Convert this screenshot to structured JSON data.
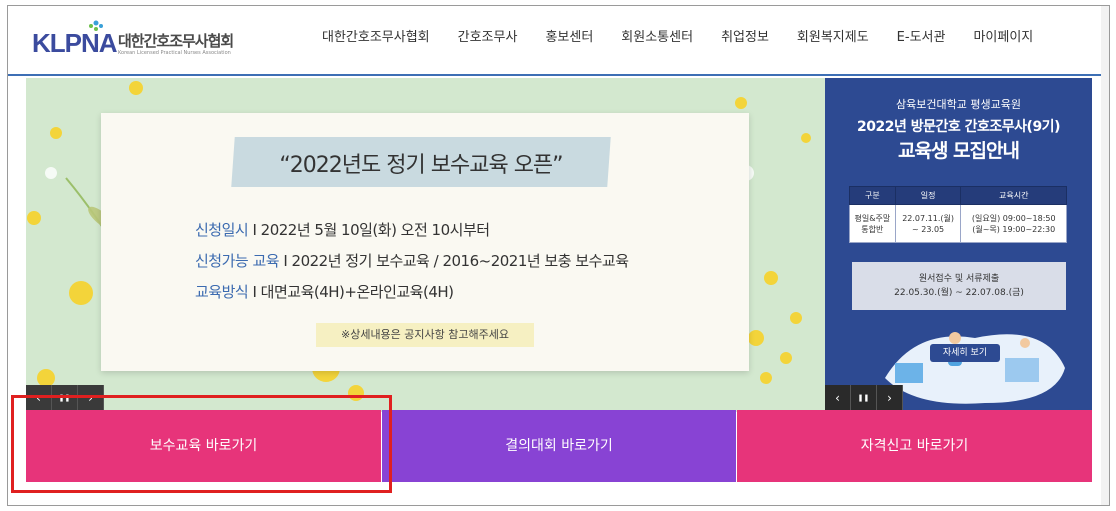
{
  "header": {
    "logo_mark": "KLPNA",
    "logo_kr": "대한간호조무사협회",
    "logo_en": "Korean Licensed Practical Nurses Association",
    "nav": [
      "대한간호조무사협회",
      "간호조무사",
      "홍보센터",
      "회원소통센터",
      "취업정보",
      "회원복지제도",
      "E-도서관",
      "마이페이지"
    ]
  },
  "banner": {
    "title": "“2022년도 정기 보수교육 오픈”",
    "lines": [
      {
        "key": "신청일시",
        "sep": " I ",
        "value": "2022년 5월 10일(화) 오전 10시부터"
      },
      {
        "key": "신청가능 교육",
        "sep": " I ",
        "value": "2022년 정기 보수교육 / 2016~2021년 보충 보수교육"
      },
      {
        "key": "교육방식",
        "sep": " I ",
        "value": "대면교육(4H)+온라인교육(4H)"
      }
    ],
    "note": "※상세내용은 공지사항 참고해주세요"
  },
  "ad": {
    "org": "삼육보건대학교 평생교육원",
    "title1": "2022년 방문간호 간호조무사(9기)",
    "title2": "교육생 모집안내",
    "table_headers": [
      "구분",
      "일정",
      "교육시간"
    ],
    "row": {
      "c1a": "평일&주말",
      "c1b": "통합반",
      "c2a": "22.07.11.(월)",
      "c2b": "~ 23.05",
      "c3a": "(일요일) 09:00~18:50",
      "c3b": "(월~목) 19:00~22:30"
    },
    "box_line1": "원서접수 및 서류제출",
    "box_line2": "22.05.30.(월) ~ 22.07.08.(금)",
    "button": "자세히 보기"
  },
  "controls": {
    "prev": "‹",
    "pause": "❚❚",
    "next": "›"
  },
  "quick_links": [
    "보수교육 바로가기",
    "결의대회 바로가기",
    "자격신고 바로가기"
  ],
  "colors": {
    "brand": "#3b4b9e",
    "pink": "#e7347a",
    "purple": "#8843d4",
    "ad_bg": "#2d4a92",
    "highlight": "#e02020"
  }
}
